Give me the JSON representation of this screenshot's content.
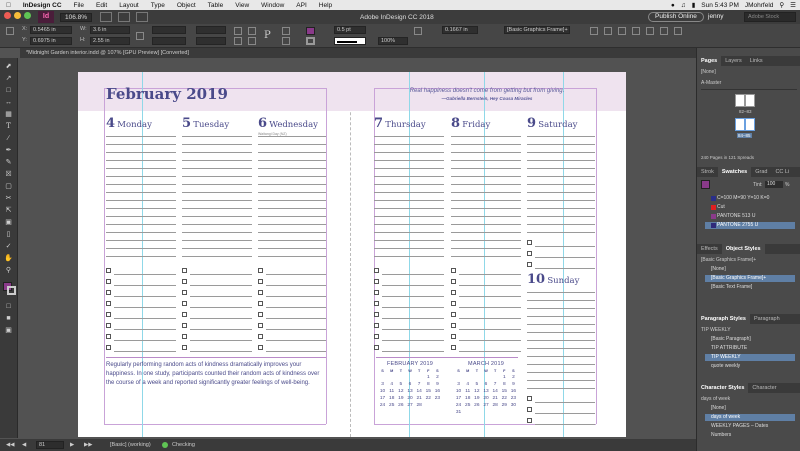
{
  "menubar": {
    "apple": "",
    "app": "InDesign CC",
    "items": [
      "File",
      "Edit",
      "Layout",
      "Type",
      "Object",
      "Table",
      "View",
      "Window",
      "API",
      "Help"
    ],
    "clock": "Sun 5:43 PM",
    "user": "JMohrfeld"
  },
  "appbar": {
    "zoom": "106.8%",
    "title": "Adobe InDesign CC 2018",
    "publish": "Publish Online",
    "user": "jenny",
    "search_placeholder": "Adobe Stock"
  },
  "control": {
    "x": "0.5465 in",
    "y": "0.6975 in",
    "w": "3.6 in",
    "h": "2.55 in",
    "stroke_weight": "0.5 pt",
    "opacity": "100%",
    "spacing": "0.1667 in",
    "style": "[Basic Graphics Frame]+"
  },
  "doc_tab": "*Midnight Garden interior.indd @ 107% [GPU Preview] [Converted]",
  "planner": {
    "month": "February 2019",
    "quote": "Real happiness doesn't come from getting but from giving.",
    "quote_attr": "—Gabriella Bernstein, Hey Cousa Miracles",
    "days": [
      {
        "num": "4",
        "name": "Monday"
      },
      {
        "num": "5",
        "name": "Tuesday"
      },
      {
        "num": "6",
        "name": "Wednesday",
        "note": "Waitangi Day (NZ)"
      },
      {
        "num": "7",
        "name": "Thursday"
      },
      {
        "num": "8",
        "name": "Friday"
      },
      {
        "num": "9",
        "name": "Saturday"
      },
      {
        "num": "10",
        "name": "Sunday"
      }
    ],
    "paragraph": "Regularly performing random acts of kindness dramatically improves your happiness. In one study, participants counted their random acts of kindness over the course of a week and reported significantly greater feelings of well-being.",
    "weekdays": [
      "S",
      "M",
      "T",
      "W",
      "T",
      "F",
      "S"
    ],
    "feb": {
      "title": "FEBRUARY 2019",
      "days": [
        "",
        "",
        "",
        "",
        "",
        "1",
        "2",
        "3",
        "4",
        "5",
        "6",
        "7",
        "8",
        "9",
        "10",
        "11",
        "12",
        "13",
        "14",
        "15",
        "16",
        "17",
        "18",
        "19",
        "20",
        "21",
        "22",
        "23",
        "24",
        "25",
        "26",
        "27",
        "28",
        "",
        ""
      ]
    },
    "mar": {
      "title": "MARCH 2019",
      "days": [
        "",
        "",
        "",
        "",
        "",
        "1",
        "2",
        "3",
        "4",
        "5",
        "6",
        "7",
        "8",
        "9",
        "10",
        "11",
        "12",
        "13",
        "14",
        "15",
        "16",
        "17",
        "18",
        "19",
        "20",
        "21",
        "22",
        "23",
        "24",
        "25",
        "26",
        "27",
        "28",
        "29",
        "30",
        "31",
        "",
        "",
        "",
        "",
        "",
        ""
      ]
    }
  },
  "status": {
    "page": "81",
    "style": "[Basic] (working)",
    "preflight": "Checking"
  },
  "panels": {
    "pages": {
      "tabs": [
        "Pages",
        "Layers",
        "Links"
      ],
      "none": "[None]",
      "master": "A-Master",
      "spread1": "82–83",
      "spread2": "84–85",
      "info": "240 Pages in 121 Spreads"
    },
    "swatches": {
      "tabs": [
        "Strok",
        "Swatches",
        "Grad",
        "CC Li"
      ],
      "tint_label": "Tint:",
      "tint": "100",
      "pct": "%",
      "items": [
        {
          "name": "C=100 M=90 Y=10 K=0",
          "color": "#2a2f8a"
        },
        {
          "name": "Cut",
          "color": "#e02020"
        },
        {
          "name": "PANTONE 513 U",
          "color": "#8a3a8a"
        },
        {
          "name": "PANTONE 2755 U",
          "color": "#2f2a7a"
        }
      ]
    },
    "object_styles": {
      "tabs": [
        "Effects",
        "Object Styles"
      ],
      "header": "[Basic Graphics Frame]+",
      "items": [
        "[None]",
        "[Basic Graphics Frame]+",
        "[Basic Text Frame]"
      ]
    },
    "paragraph_styles": {
      "tabs": [
        "Paragraph Styles",
        "Paragraph"
      ],
      "header": "TIP WEEKLY",
      "items": [
        "[Basic Paragraph]",
        "TIP ATTRIBUTE",
        "TIP WEEKLY",
        "quote weekly"
      ]
    },
    "character_styles": {
      "tabs": [
        "Character Styles",
        "Character"
      ],
      "header": "days of week",
      "items": [
        "[None]",
        "days of week",
        "WEEKLY PAGES – Dates",
        "Numbers"
      ]
    }
  },
  "colors": {
    "accent": "#4a4a8a",
    "band": "#efe3ef",
    "guide": "#c9a3d8",
    "selection": "#5f7fa5"
  }
}
